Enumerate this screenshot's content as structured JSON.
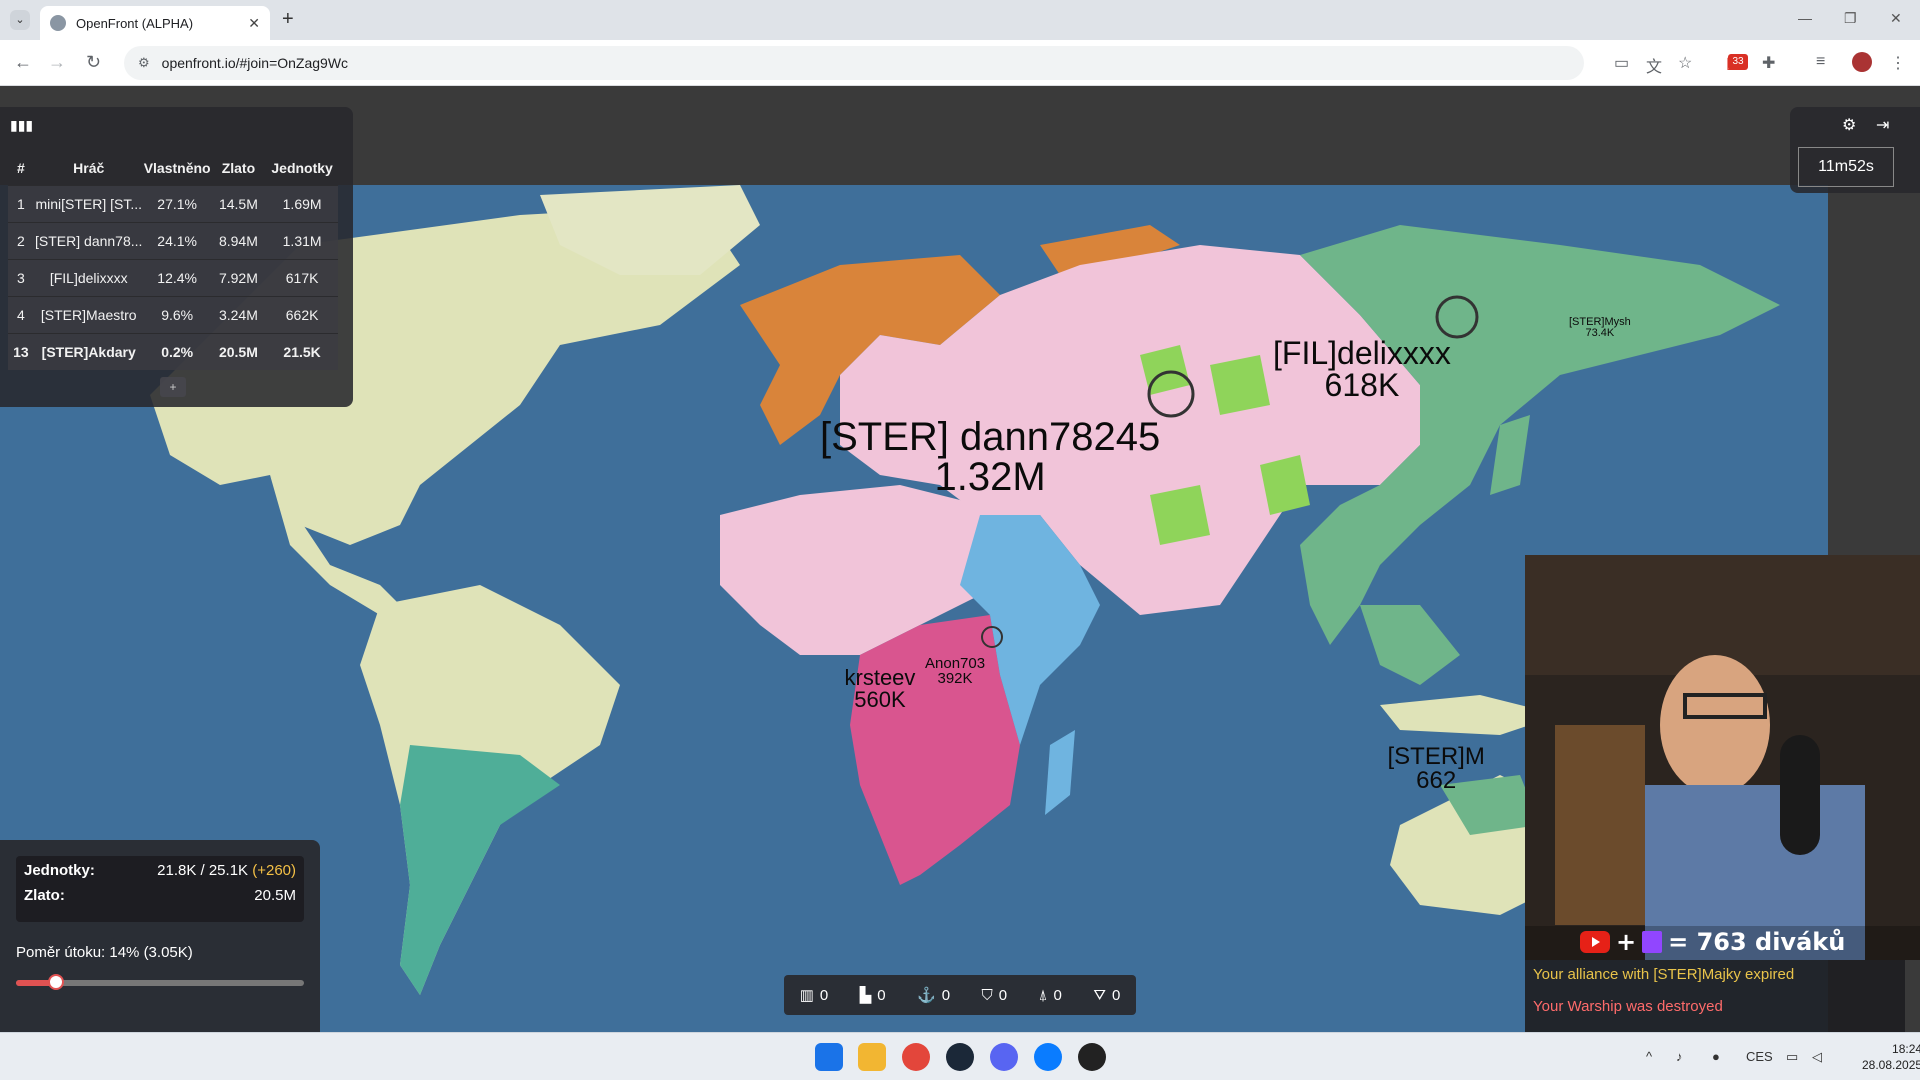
{
  "browser": {
    "tab_title": "OpenFront (ALPHA)",
    "url": "openfront.io/#join=OnZag9Wc",
    "extension_badge": "33",
    "new_tab": "+",
    "close_tab": "✕"
  },
  "leaderboard": {
    "headers": [
      "#",
      "Hráč",
      "Vlastněno",
      "Zlato",
      "Jednotky"
    ],
    "rows": [
      {
        "rank": "1",
        "player": "mini[STER] [ST...",
        "owned": "27.1%",
        "gold": "14.5M",
        "units": "1.69M"
      },
      {
        "rank": "2",
        "player": "[STER] dann78...",
        "owned": "24.1%",
        "gold": "8.94M",
        "units": "1.31M"
      },
      {
        "rank": "3",
        "player": "[FIL]delixxxx",
        "owned": "12.4%",
        "gold": "7.92M",
        "units": "617K"
      },
      {
        "rank": "4",
        "player": "[STER]Maestro",
        "owned": "9.6%",
        "gold": "3.24M",
        "units": "662K"
      },
      {
        "rank": "13",
        "player": "[STER]Akdary",
        "owned": "0.2%",
        "gold": "20.5M",
        "units": "21.5K"
      }
    ],
    "more": "+"
  },
  "timer": "11m52s",
  "map_labels": {
    "dann": {
      "name": "[STER] dann78245",
      "units": "1.32M"
    },
    "delix": {
      "name": "[FIL]delixxxx",
      "units": "618K"
    },
    "krsteev": {
      "name": "krsteev",
      "units": "560K"
    },
    "anon": {
      "name": "Anon703",
      "units": "392K"
    },
    "mysh": {
      "name": "[STER]Mysh",
      "units": "73.4K"
    },
    "sterm": {
      "name": "[STER]M",
      "units": "662"
    }
  },
  "stats": {
    "units_label": "Jednotky:",
    "units_value": "21.8K / 25.1K",
    "units_plus": "(+260)",
    "gold_label": "Zlato:",
    "gold_value": "20.5M",
    "ratio_text": "Poměr útoku: 14% (3.05K)",
    "ratio_percent": 14
  },
  "unit_counts": {
    "city": "0",
    "factory": "0",
    "port": "0",
    "defense": "0",
    "missile_silo": "0",
    "sam": "0"
  },
  "stream": {
    "viewers": "= 763 diváků",
    "plus": "+"
  },
  "events": {
    "e1": "Your alliance with [STER]Majky expired",
    "e2": "Your Warship was destroyed"
  },
  "taskbar": {
    "lang": "CES",
    "time": "18:24",
    "date": "28.08.2025"
  },
  "colors": {
    "ocean": "#3f6f9a",
    "pink_empire": "#f1c4d9",
    "orange_empire": "#d9843a",
    "magenta_empire": "#d9558f",
    "green_empire": "#6fb58a",
    "lime_empire": "#8fd45a",
    "blue_empire": "#6fb4e0",
    "neutral_land": "#dfe3b8",
    "teal_empire": "#4fae98"
  }
}
